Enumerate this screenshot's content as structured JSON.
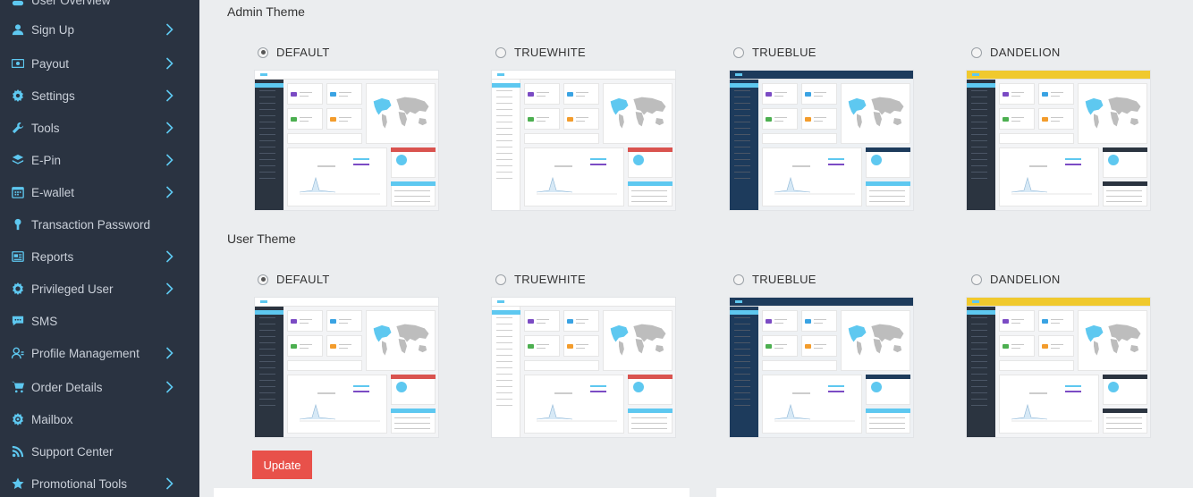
{
  "sidebar": {
    "items": [
      {
        "label": "User Overview",
        "icon": "users-icon",
        "has_arrow": false
      },
      {
        "label": "Sign Up",
        "icon": "user-icon",
        "has_arrow": true
      },
      {
        "label": "Payout",
        "icon": "money-icon",
        "has_arrow": true
      },
      {
        "label": "Settings",
        "icon": "gear-icon",
        "has_arrow": true
      },
      {
        "label": "Tools",
        "icon": "wrench-icon",
        "has_arrow": true
      },
      {
        "label": "E-Pin",
        "icon": "layers-icon",
        "has_arrow": true
      },
      {
        "label": "E-wallet",
        "icon": "calendar-icon",
        "has_arrow": true
      },
      {
        "label": "Transaction Password",
        "icon": "key-icon",
        "has_arrow": false
      },
      {
        "label": "Reports",
        "icon": "report-icon",
        "has_arrow": true
      },
      {
        "label": "Privileged User",
        "icon": "cog-user-icon",
        "has_arrow": true
      },
      {
        "label": "SMS",
        "icon": "chat-icon",
        "has_arrow": false
      },
      {
        "label": "Profile Management",
        "icon": "profile-icon",
        "has_arrow": true
      },
      {
        "label": "Order Details",
        "icon": "cart-icon",
        "has_arrow": true
      },
      {
        "label": "Mailbox",
        "icon": "mail-gear-icon",
        "has_arrow": false
      },
      {
        "label": "Support Center",
        "icon": "rss-icon",
        "has_arrow": false
      },
      {
        "label": "Promotional Tools",
        "icon": "star-icon",
        "has_arrow": true
      }
    ]
  },
  "admin_theme": {
    "title": "Admin Theme",
    "options": [
      {
        "label": "DEFAULT",
        "checked": true
      },
      {
        "label": "TRUEWHITE",
        "checked": false
      },
      {
        "label": "TRUEBLUE",
        "checked": false
      },
      {
        "label": "DANDELION",
        "checked": false
      }
    ]
  },
  "user_theme": {
    "title": "User Theme",
    "options": [
      {
        "label": "DEFAULT",
        "checked": true
      },
      {
        "label": "TRUEWHITE",
        "checked": false
      },
      {
        "label": "TRUEBLUE",
        "checked": false
      },
      {
        "label": "DANDELION",
        "checked": false
      }
    ]
  },
  "update_button": "Update",
  "colors": {
    "sidebar_bg": "#2a3341",
    "accent": "#5ec8f0",
    "update": "#e8514a",
    "default_side": "#2b3440",
    "truewhite_side": "#ffffff",
    "trueblue_side": "#1d3b5c",
    "dandelion_side": "#2b3440",
    "dandelion_top": "#f0c92e"
  }
}
